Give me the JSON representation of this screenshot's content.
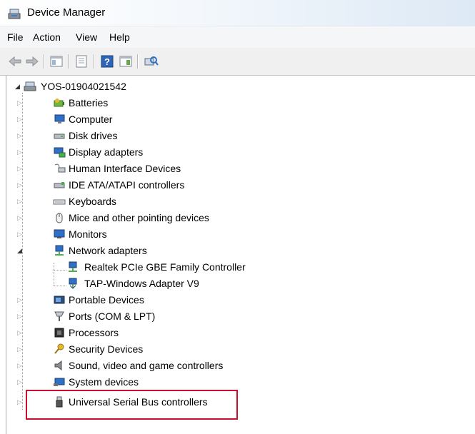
{
  "window": {
    "title": "Device Manager"
  },
  "menu": [
    "File",
    "Action",
    "View",
    "Help"
  ],
  "toolbar": {
    "buttons": [
      "back-arrow-icon",
      "forward-arrow-icon",
      "show-hide-console-tree-icon",
      "properties-icon",
      "help-icon",
      "action-pane-icon",
      "scan-hardware-icon"
    ]
  },
  "tree": {
    "root": "YOS-01904021542",
    "categories": [
      {
        "label": "Batteries",
        "icon": "battery-icon",
        "expanded": false
      },
      {
        "label": "Computer",
        "icon": "computer-icon",
        "expanded": false
      },
      {
        "label": "Disk drives",
        "icon": "disk-drive-icon",
        "expanded": false
      },
      {
        "label": "Display adapters",
        "icon": "display-adapter-icon",
        "expanded": false
      },
      {
        "label": "Human Interface Devices",
        "icon": "hid-icon",
        "expanded": false
      },
      {
        "label": "IDE ATA/ATAPI controllers",
        "icon": "ide-controller-icon",
        "expanded": false
      },
      {
        "label": "Keyboards",
        "icon": "keyboard-icon",
        "expanded": false
      },
      {
        "label": "Mice and other pointing devices",
        "icon": "mouse-icon",
        "expanded": false
      },
      {
        "label": "Monitors",
        "icon": "monitor-icon",
        "expanded": false
      },
      {
        "label": "Network adapters",
        "icon": "network-adapter-icon",
        "expanded": true,
        "children": [
          "Realtek PCIe GBE Family Controller",
          "TAP-Windows Adapter V9"
        ]
      },
      {
        "label": "Portable Devices",
        "icon": "portable-device-icon",
        "expanded": false
      },
      {
        "label": "Ports (COM & LPT)",
        "icon": "port-icon",
        "expanded": false
      },
      {
        "label": "Processors",
        "icon": "processor-icon",
        "expanded": false
      },
      {
        "label": "Security Devices",
        "icon": "security-key-icon",
        "expanded": false
      },
      {
        "label": "Sound, video and game controllers",
        "icon": "sound-icon",
        "expanded": false
      },
      {
        "label": "System devices",
        "icon": "system-device-icon",
        "expanded": false
      },
      {
        "label": "Universal Serial Bus controllers",
        "icon": "usb-icon",
        "expanded": false
      }
    ]
  },
  "annotation": {
    "highlight_color": "#c8102e",
    "highlighted_item": "Universal Serial Bus controllers"
  }
}
